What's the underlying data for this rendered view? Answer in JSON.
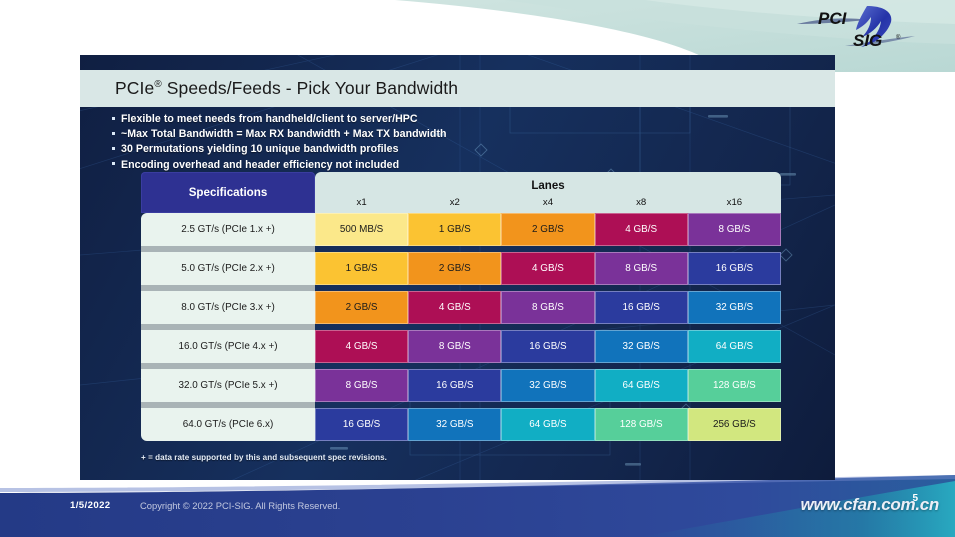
{
  "slide": {
    "title": "PCIe® Speeds/Feeds - Pick Your Bandwidth",
    "title_main": "PCIe",
    "title_reg": "®",
    "title_rest": " Speeds/Feeds - Pick Your Bandwidth",
    "bullets": [
      "Flexible to meet needs from handheld/client to server/HPC",
      "~Max Total Bandwidth = Max RX bandwidth + Max TX bandwidth",
      "30 Permutations yielding 10 unique bandwidth profiles",
      "Encoding overhead and header efficiency not included"
    ],
    "footnote": "+ = data rate supported by this and subsequent spec revisions."
  },
  "table": {
    "spec_header": "Specifications",
    "lanes_header": "Lanes",
    "lane_columns": [
      "x1",
      "x2",
      "x4",
      "x8",
      "x16"
    ],
    "rows": [
      {
        "spec": "2.5 GT/s (PCIe 1.x +)",
        "values": [
          "500 MB/S",
          "1 GB/S",
          "2 GB/S",
          "4 GB/S",
          "8 GB/S"
        ]
      },
      {
        "spec": "5.0 GT/s (PCIe 2.x +)",
        "values": [
          "1 GB/S",
          "2 GB/S",
          "4 GB/S",
          "8 GB/S",
          "16 GB/S"
        ]
      },
      {
        "spec": "8.0 GT/s (PCIe 3.x +)",
        "values": [
          "2 GB/S",
          "4 GB/S",
          "8 GB/S",
          "16 GB/S",
          "32 GB/S"
        ]
      },
      {
        "spec": "16.0 GT/s (PCIe 4.x +)",
        "values": [
          "4 GB/S",
          "8 GB/S",
          "16 GB/S",
          "32 GB/S",
          "64 GB/S"
        ]
      },
      {
        "spec": "32.0 GT/s (PCIe 5.x +)",
        "values": [
          "8 GB/S",
          "16 GB/S",
          "32 GB/S",
          "64 GB/S",
          "128 GB/S"
        ]
      },
      {
        "spec": "64.0 GT/s (PCIe 6.x)",
        "values": [
          "16 GB/S",
          "32 GB/S",
          "64 GB/S",
          "128 GB/S",
          "256 GB/S"
        ]
      }
    ],
    "value_colors": {
      "500 MB/S": {
        "bg": "#fbe88a",
        "fg": "#1b1b1b"
      },
      "1 GB/S": {
        "bg": "#fbc332",
        "fg": "#1b1b1b"
      },
      "2 GB/S": {
        "bg": "#f2941c",
        "fg": "#1b1b1b"
      },
      "4 GB/S": {
        "bg": "#ad0f55",
        "fg": "#ffffff"
      },
      "8 GB/S": {
        "bg": "#7a3299",
        "fg": "#ffffff"
      },
      "16 GB/S": {
        "bg": "#2b3b9e",
        "fg": "#ffffff"
      },
      "32 GB/S": {
        "bg": "#1173bb",
        "fg": "#ffffff"
      },
      "64 GB/S": {
        "bg": "#11aec4",
        "fg": "#ffffff"
      },
      "128 GB/S": {
        "bg": "#56cf9a",
        "fg": "#ffffff"
      },
      "256 GB/S": {
        "bg": "#d2e77f",
        "fg": "#1b1b1b"
      }
    }
  },
  "footer": {
    "date": "1/5/2022",
    "copyright": "Copyright © 2022 PCI-SIG. All Rights Reserved.",
    "page_number": "5",
    "watermark": "www.cfan.com.cn"
  },
  "logo": {
    "top_text": "PCI",
    "bottom_text": "SIG",
    "trademark": "®"
  },
  "colors": {
    "title_band": "#d9e7e6",
    "spec_header": "#2e3192",
    "lanes_header": "#d6e6e4",
    "spec_cell": "#e9f3ee",
    "slide_bg": "#13264d",
    "footer_bar": "#2b3b8f"
  }
}
